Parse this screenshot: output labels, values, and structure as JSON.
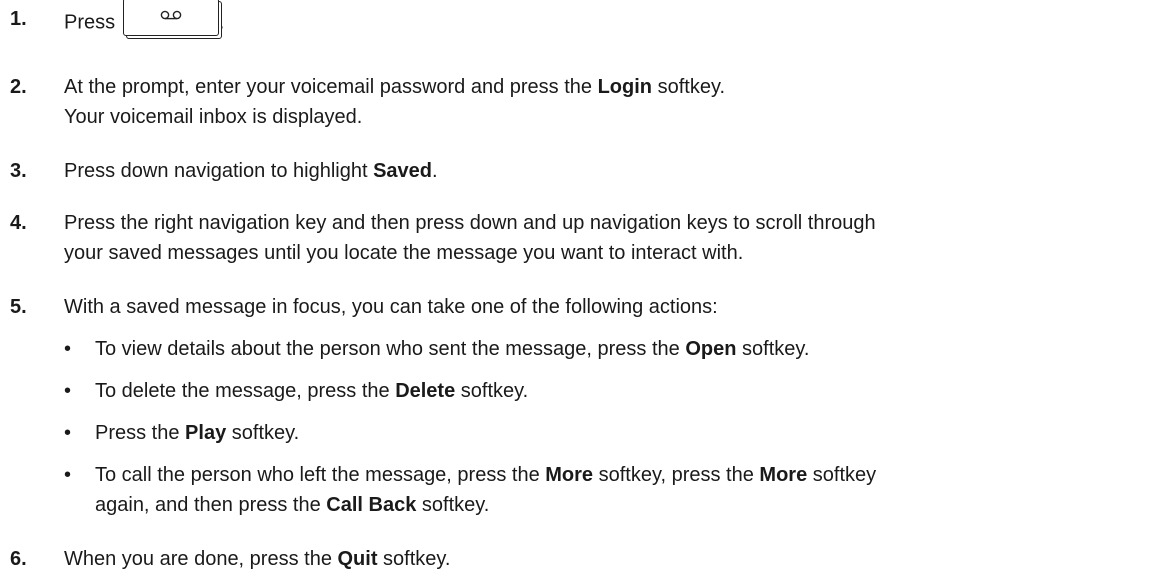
{
  "steps": [
    {
      "number": "1.",
      "text_before_key": "Press",
      "key_icon": "voicemail-icon",
      "text_after_key": "."
    },
    {
      "number": "2.",
      "line1": {
        "a": "At the prompt, enter your voicemail password and press the ",
        "b": "Login",
        "c": " softkey."
      },
      "line2": "Your voicemail inbox is displayed."
    },
    {
      "number": "3.",
      "line1": {
        "a": "Press down navigation to highlight ",
        "b": "Saved",
        "c": "."
      }
    },
    {
      "number": "4.",
      "line1": "Press the right navigation key and then press down and up navigation keys to scroll through",
      "line2": "your saved messages until you locate the message you want to interact with."
    },
    {
      "number": "5.",
      "line1": "With a saved message in focus, you can take one of the following actions:",
      "bullets": [
        {
          "marker": "•",
          "a": "To view details about the person who sent the message, press the ",
          "b": "Open",
          "c": " softkey."
        },
        {
          "marker": "•",
          "a": "To delete the message, press the ",
          "b": "Delete",
          "c": " softkey."
        },
        {
          "marker": "•",
          "a": "Press the ",
          "b": "Play",
          "c": " softkey."
        },
        {
          "marker": "•",
          "a": "To call the person who left the message, press the ",
          "b": "More",
          "c": " softkey, press the ",
          "d": "More",
          "e": " softkey",
          "f": "again, and then press the ",
          "g": "Call Back",
          "h": " softkey."
        }
      ]
    },
    {
      "number": "6.",
      "line1": {
        "a": "When you are done, press the ",
        "b": "Quit",
        "c": " softkey."
      }
    }
  ]
}
